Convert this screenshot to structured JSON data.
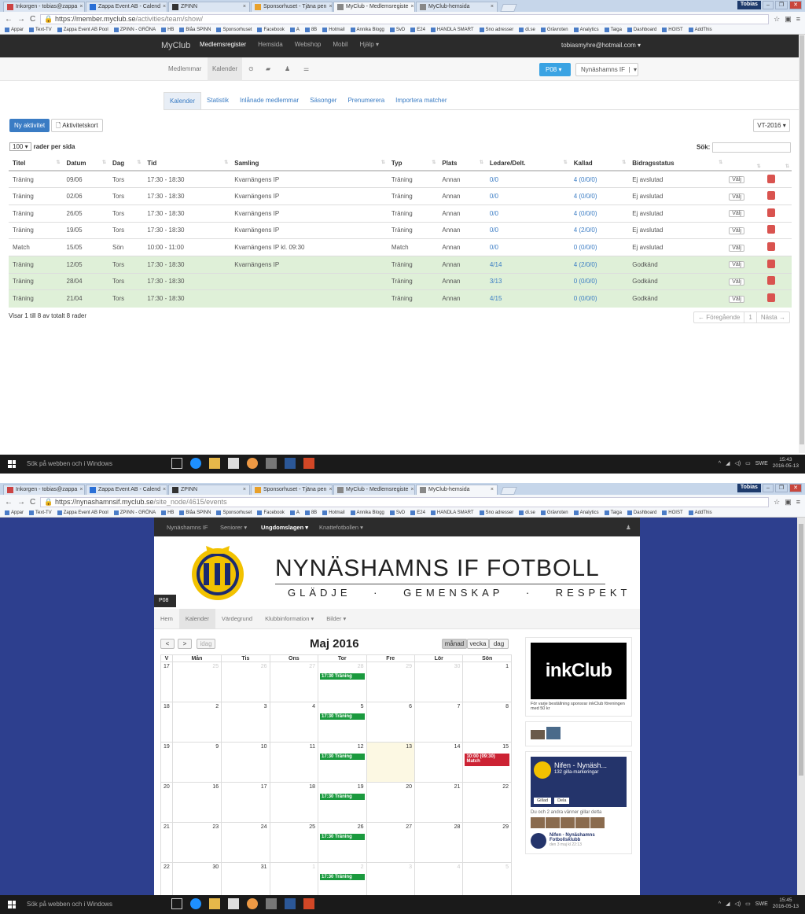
{
  "shot1": {
    "tabs": [
      "Inkorgen - tobias@zappa",
      "Zappa Event AB - Calend",
      "ZPINN",
      "Sponsorhuset - Tjäna pen",
      "MyClub - Medlemsregiste",
      "MyClub-hemsida"
    ],
    "user_badge": "Tobias",
    "url_host": "https://member.myclub.se",
    "url_path": "/activities/team/show/",
    "bookmarks": [
      "Appar",
      "Text-TV",
      "Zappa Event AB Pool",
      "ZPINN - GRÖNA",
      "HB",
      "Blåa SPINN",
      "Sponsorhuset",
      "Facebook",
      "A",
      "8B",
      "Hotmail",
      "Annika Blogg",
      "SvD",
      "E24",
      "HANDLA SMART",
      "Sno adresser",
      "di.se",
      "Grävroten",
      "Analytics",
      "Taiga",
      "Dashboard",
      "HOIST",
      "AddThis"
    ],
    "nav": {
      "brand": "MyClub",
      "links": [
        "Medlemsregister",
        "Hemsida",
        "Webshop",
        "Mobil",
        "Hjälp ▾"
      ],
      "account": "tobiasmyhre@hotmail.com ▾"
    },
    "subnav": {
      "items": [
        "Medlemmar",
        "Kalender"
      ],
      "team": "P08",
      "club": "Nynäshamns IF"
    },
    "tabs_cal": [
      "Kalender",
      "Statistik",
      "Inlånade medlemmar",
      "Säsonger",
      "Prenumerera",
      "Importera matcher"
    ],
    "btn_new": "Ny aktivitet",
    "btn_card": "Aktivitetskort",
    "season": "VT-2016 ▾",
    "per_page_value": "100 ▾",
    "per_page_label": "rader per sida",
    "search_label": "Sök:",
    "columns": [
      "Titel",
      "Datum",
      "Dag",
      "Tid",
      "Samling",
      "Typ",
      "Plats",
      "Ledare/Delt.",
      "Kallad",
      "Bidragsstatus",
      "",
      ""
    ],
    "rows": [
      {
        "titel": "Träning",
        "datum": "09/06",
        "dag": "Tors",
        "tid": "17:30 - 18:30",
        "samling": "Kvarnängens IP",
        "typ": "Träning",
        "plats": "Annan",
        "ledare": "0/0",
        "kallad": "4 (0/0/0)",
        "status": "Ej avslutad",
        "green": false
      },
      {
        "titel": "Träning",
        "datum": "02/06",
        "dag": "Tors",
        "tid": "17:30 - 18:30",
        "samling": "Kvarnängens IP",
        "typ": "Träning",
        "plats": "Annan",
        "ledare": "0/0",
        "kallad": "4 (0/0/0)",
        "status": "Ej avslutad",
        "green": false
      },
      {
        "titel": "Träning",
        "datum": "26/05",
        "dag": "Tors",
        "tid": "17:30 - 18:30",
        "samling": "Kvarnängens IP",
        "typ": "Träning",
        "plats": "Annan",
        "ledare": "0/0",
        "kallad": "4 (0/0/0)",
        "status": "Ej avslutad",
        "green": false
      },
      {
        "titel": "Träning",
        "datum": "19/05",
        "dag": "Tors",
        "tid": "17:30 - 18:30",
        "samling": "Kvarnängens IP",
        "typ": "Träning",
        "plats": "Annan",
        "ledare": "0/0",
        "kallad": "4 (2/0/0)",
        "status": "Ej avslutad",
        "green": false
      },
      {
        "titel": "Match",
        "datum": "15/05",
        "dag": "Sön",
        "tid": "10:00 - 11:00",
        "samling": "Kvarnängens IP kl. 09:30",
        "typ": "Match",
        "plats": "Annan",
        "ledare": "0/0",
        "kallad": "0 (0/0/0)",
        "status": "Ej avslutad",
        "green": false
      },
      {
        "titel": "Träning",
        "datum": "12/05",
        "dag": "Tors",
        "tid": "17:30 - 18:30",
        "samling": "Kvarnängens IP",
        "typ": "Träning",
        "plats": "Annan",
        "ledare": "4/14",
        "kallad": "4 (2/0/0)",
        "status": "Godkänd",
        "green": true
      },
      {
        "titel": "Träning",
        "datum": "28/04",
        "dag": "Tors",
        "tid": "17:30 - 18:30",
        "samling": "",
        "typ": "Träning",
        "plats": "Annan",
        "ledare": "3/13",
        "kallad": "0 (0/0/0)",
        "status": "Godkänd",
        "green": true
      },
      {
        "titel": "Träning",
        "datum": "21/04",
        "dag": "Tors",
        "tid": "17:30 - 18:30",
        "samling": "",
        "typ": "Träning",
        "plats": "Annan",
        "ledare": "4/15",
        "kallad": "0 (0/0/0)",
        "status": "Godkänd",
        "green": true
      }
    ],
    "valj": "Välj",
    "footer_info": "Visar 1 till 8 av totalt 8 rader",
    "pager": [
      "← Föregående",
      "1",
      "Nästa →"
    ],
    "taskbar": {
      "search": "Sök på webben och i Windows",
      "lang": "SWE",
      "time": "15:43",
      "date": "2016-05-13"
    }
  },
  "shot2": {
    "tabs": [
      "Inkorgen - tobias@zappa",
      "Zappa Event AB - Calend",
      "ZPINN",
      "Sponsorhuset - Tjäna pen",
      "MyClub - Medlemsregiste",
      "MyClub-hemsida"
    ],
    "user_badge": "Tobias",
    "url_host": "https://nynashamnsif.myclub.se",
    "url_path": "/site_node/4615/events",
    "bookmarks": [
      "Appar",
      "Text-TV",
      "Zappa Event AB Pool",
      "ZPINN - GRÖNA",
      "HB",
      "Blåa SPINN",
      "Sponsorhuset",
      "Facebook",
      "A",
      "8B",
      "Hotmail",
      "Annika Blogg",
      "SvD",
      "E24",
      "HANDLA SMART",
      "Sno adresser",
      "di.se",
      "Grävroten",
      "Analytics",
      "Taiga",
      "Dashboard",
      "HOIST",
      "AddThis"
    ],
    "site_nav": [
      "Nynäshamns IF",
      "Seniorer ▾",
      "Ungdomslagen ▾",
      "Knattefotbollen ▾"
    ],
    "title": "NYNÄSHAMNS IF FOTBOLL",
    "tagline": "GLÄDJE · GEMENSKAP · RESPEKT",
    "team_tag": "P08",
    "menu": [
      "Hem",
      "Kalender",
      "Värdegrund",
      "Klubbinformation ▾",
      "Bilder ▾"
    ],
    "cal": {
      "prev": "<",
      "next": ">",
      "today": "idag",
      "title": "Maj 2016",
      "views": [
        "månad",
        "vecka",
        "dag"
      ],
      "headers": [
        "V",
        "Mån",
        "Tis",
        "Ons",
        "Tor",
        "Fre",
        "Lör",
        "Sön"
      ],
      "weeks": [
        {
          "wk": "17",
          "days": [
            "25",
            "26",
            "27",
            "28",
            "29",
            "30",
            "1"
          ]
        },
        {
          "wk": "18",
          "days": [
            "2",
            "3",
            "4",
            "5",
            "6",
            "7",
            "8"
          ]
        },
        {
          "wk": "19",
          "days": [
            "9",
            "10",
            "11",
            "12",
            "13",
            "14",
            "15"
          ]
        },
        {
          "wk": "20",
          "days": [
            "16",
            "17",
            "18",
            "19",
            "20",
            "21",
            "22"
          ]
        },
        {
          "wk": "21",
          "days": [
            "23",
            "24",
            "25",
            "26",
            "27",
            "28",
            "29"
          ]
        },
        {
          "wk": "22",
          "days": [
            "30",
            "31",
            "1",
            "2",
            "3",
            "4",
            "5"
          ]
        }
      ],
      "event_training": "17:30 Träning",
      "event_match_time": "10:00 (09:30)",
      "event_match_label": "Match"
    },
    "sponsor": {
      "logo": "inkClub",
      "text": "För varje beställning sponsrar inkClub föreningen med 50 kr"
    },
    "fb": {
      "name": "Nifen - Nynäsh...",
      "likes": "132 gilla-markeringar",
      "liked": "Gillad",
      "share": "Dela",
      "friends": "Du och 2 andra vänner gillar detta",
      "post_title": "Nifen - Nynäshamns Fotbollsklubb",
      "post_date": "den 3 maj kl 22:13"
    },
    "taskbar": {
      "search": "Sök på webben och i Windows",
      "lang": "SWE",
      "time": "15:45",
      "date": "2016-05-13"
    }
  }
}
